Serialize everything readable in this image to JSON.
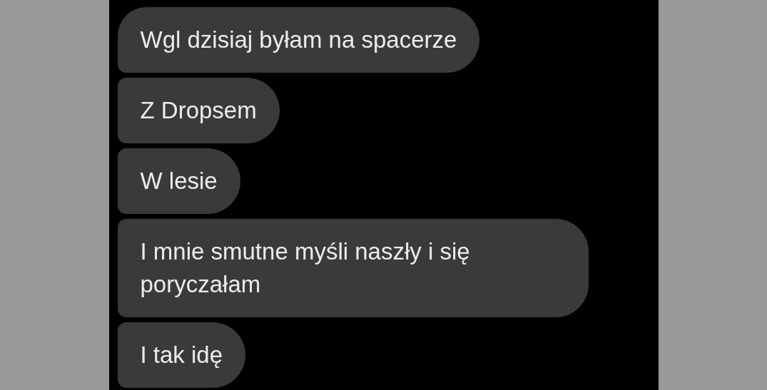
{
  "messages": [
    {
      "text": "Wgl dzisiaj byłam na spacerze"
    },
    {
      "text": "Z Dropsem"
    },
    {
      "text": "W lesie"
    },
    {
      "text": "I mnie smutne myśli naszły i się poryczałam"
    },
    {
      "text": "I tak idę"
    }
  ]
}
